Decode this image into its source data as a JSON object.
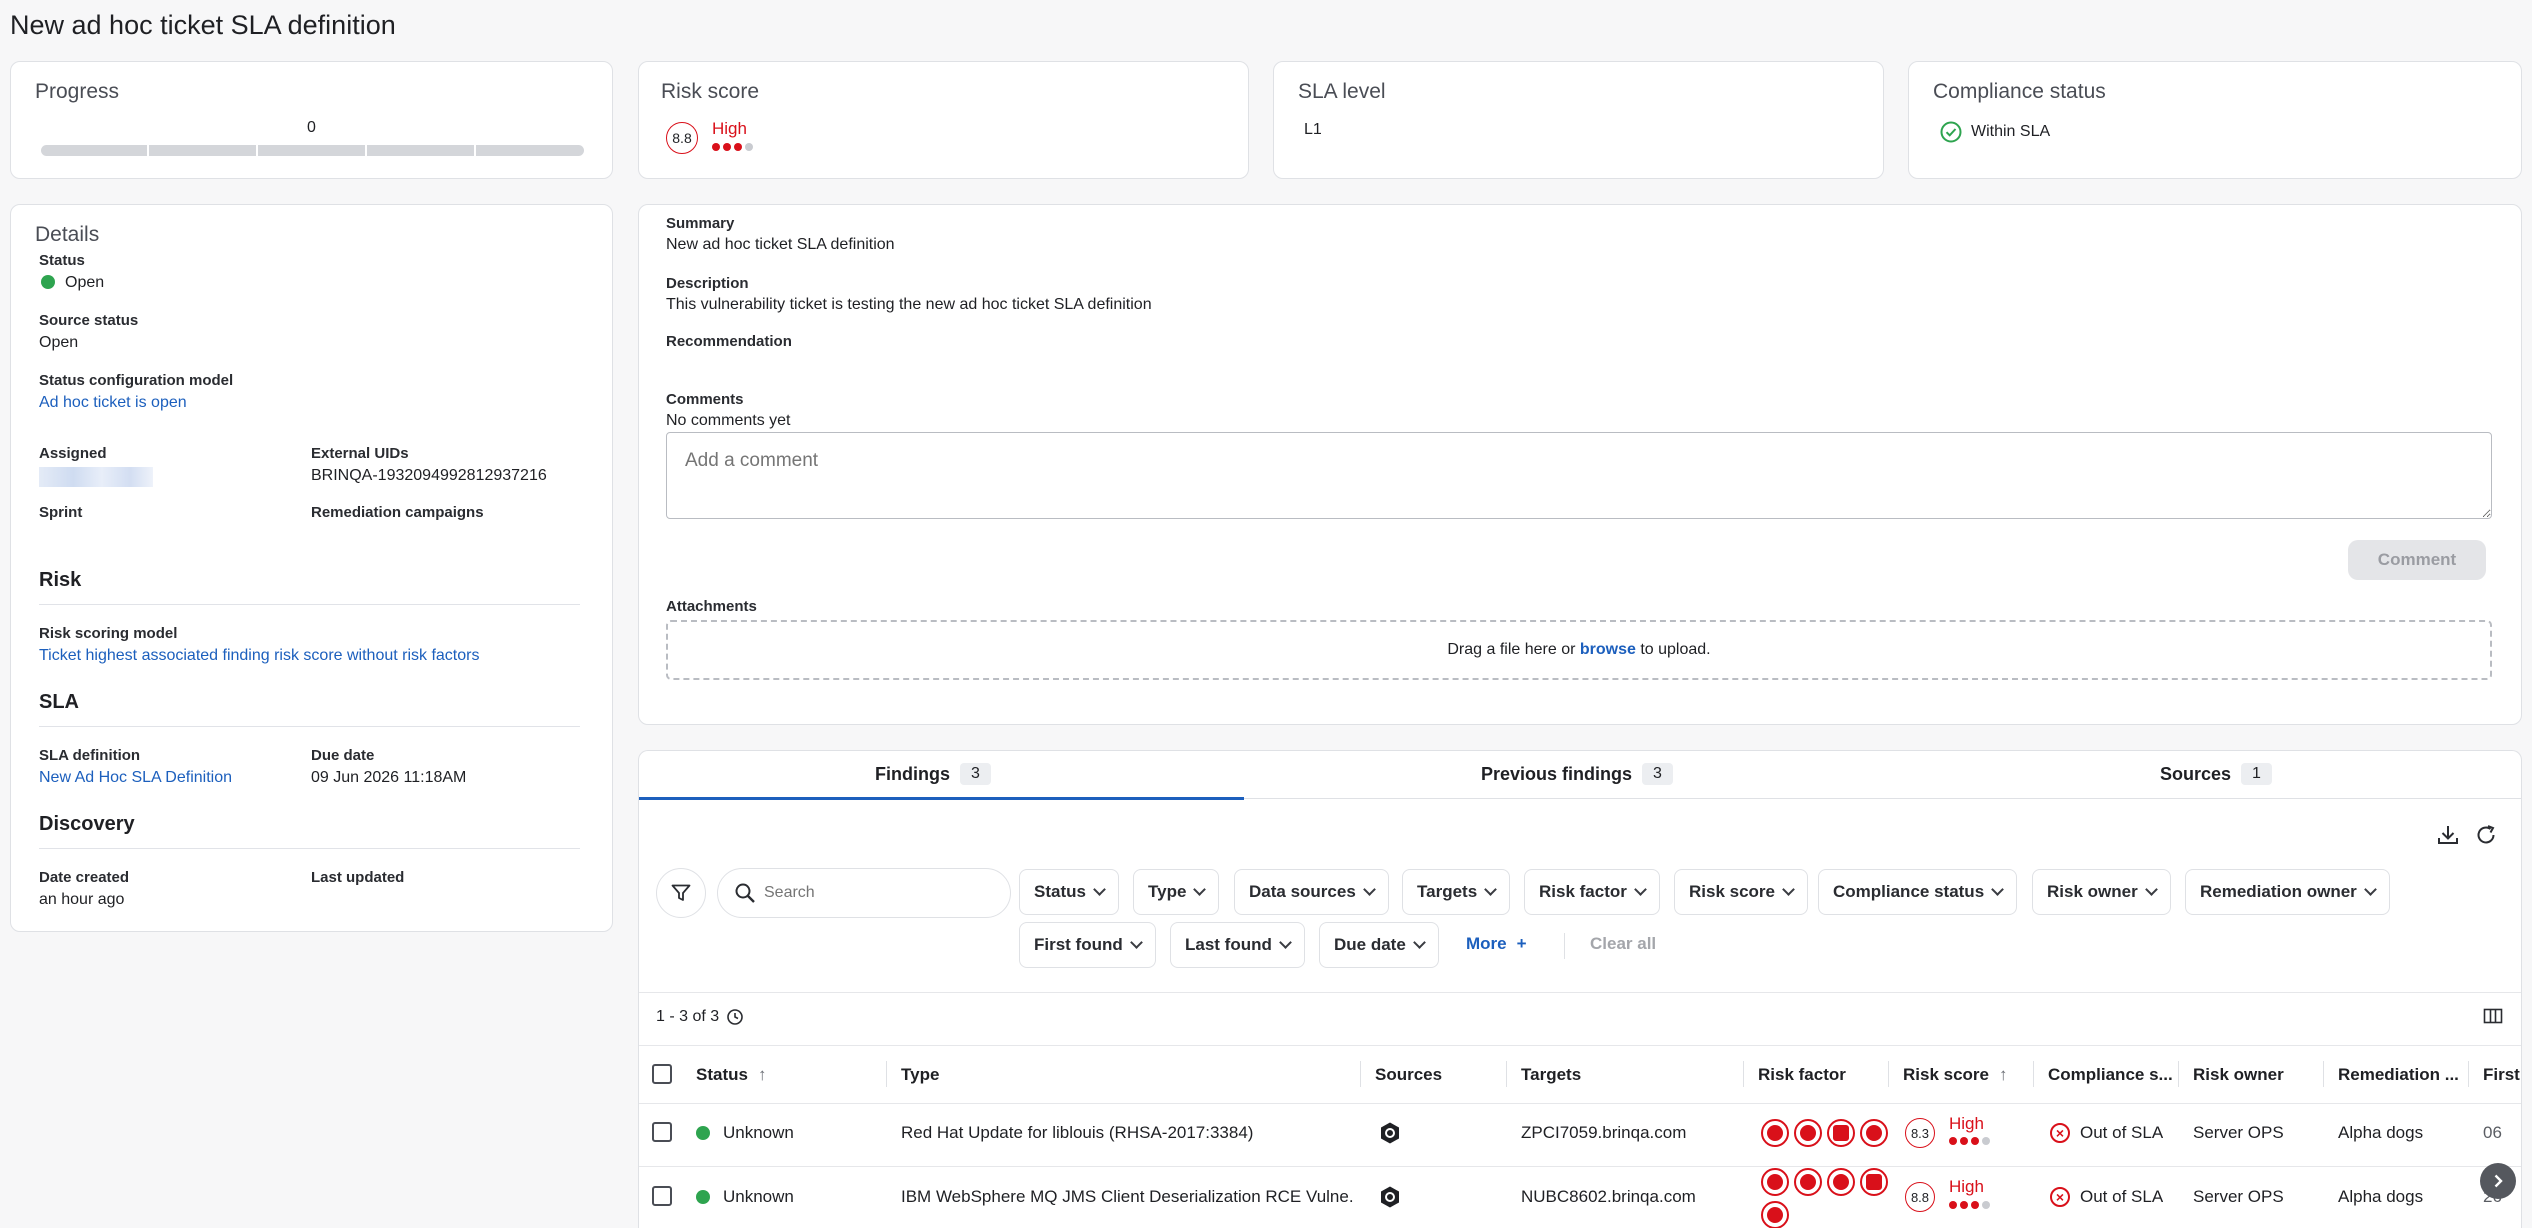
{
  "page": {
    "title": "New ad hoc ticket SLA definition"
  },
  "progress": {
    "title": "Progress",
    "value": "0"
  },
  "risk_score": {
    "title": "Risk score",
    "score": "8.8",
    "level": "High",
    "dots_filled": 3,
    "dots_total": 4
  },
  "sla_level": {
    "title": "SLA level",
    "value": "L1"
  },
  "compliance": {
    "title": "Compliance status",
    "value": "Within SLA"
  },
  "details": {
    "title": "Details",
    "status_label": "Status",
    "status_value": "Open",
    "source_status_label": "Source status",
    "source_status_value": "Open",
    "status_config_label": "Status configuration model",
    "status_config_value": "Ad hoc ticket is open",
    "assigned_label": "Assigned",
    "external_uids_label": "External UIDs",
    "external_uids_value": "BRINQA-1932094992812937216",
    "sprint_label": "Sprint",
    "remediation_campaigns_label": "Remediation campaigns",
    "risk_section": "Risk",
    "risk_model_label": "Risk scoring model",
    "risk_model_value": "Ticket highest associated finding risk score without risk factors",
    "sla_section": "SLA",
    "sla_def_label": "SLA definition",
    "sla_def_value": "New Ad Hoc SLA Definition",
    "due_date_label": "Due date",
    "due_date_value": "09 Jun 2026 11:18AM",
    "discovery_section": "Discovery",
    "date_created_label": "Date created",
    "date_created_value": "an hour ago",
    "last_updated_label": "Last updated"
  },
  "summary": {
    "summary_label": "Summary",
    "summary_value": "New ad hoc ticket SLA definition",
    "description_label": "Description",
    "description_value": "This vulnerability ticket is testing the new ad hoc ticket SLA definition",
    "recommendation_label": "Recommendation",
    "comments_label": "Comments",
    "comments_value": "No comments yet",
    "comment_placeholder": "Add a comment",
    "comment_button": "Comment",
    "attachments_label": "Attachments",
    "drop_text_before": "Drag a file here or ",
    "drop_browse": "browse",
    "drop_text_after": " to upload."
  },
  "tabs": [
    {
      "label": "Findings",
      "count": "3"
    },
    {
      "label": "Previous findings",
      "count": "3"
    },
    {
      "label": "Sources",
      "count": "1"
    }
  ],
  "filters": {
    "search_placeholder": "Search",
    "chips": [
      "Status",
      "Type",
      "Data sources",
      "Targets",
      "Risk factor",
      "Risk score",
      "Compliance status",
      "Risk owner",
      "Remediation owner",
      "First found",
      "Last found",
      "Due date"
    ],
    "more": "More",
    "clear_all": "Clear all"
  },
  "table": {
    "range": "1 - 3 of 3",
    "headers": [
      "Status",
      "Type",
      "Sources",
      "Targets",
      "Risk factor",
      "Risk score",
      "Compliance s...",
      "Risk owner",
      "Remediation ...",
      "First"
    ],
    "rows": [
      {
        "status": "Unknown",
        "type": "Red Hat Update for liblouis (RHSA-2017:3384)",
        "target": "ZPCI7059.brinqa.com",
        "score": "8.3",
        "level": "High",
        "compliance": "Out of SLA",
        "risk_owner": "Server OPS",
        "remediation_owner": "Alpha dogs",
        "first": "06"
      },
      {
        "status": "Unknown",
        "type": "IBM WebSphere MQ JMS Client Deserialization RCE Vulne...",
        "target": "NUBC8602.brinqa.com",
        "score": "8.8",
        "level": "High",
        "compliance": "Out of SLA",
        "risk_owner": "Server OPS",
        "remediation_owner": "Alpha dogs",
        "first": "26"
      }
    ]
  },
  "colors": {
    "accent": "#1c5fbd",
    "danger": "#d9101a",
    "success": "#2ea44f"
  }
}
